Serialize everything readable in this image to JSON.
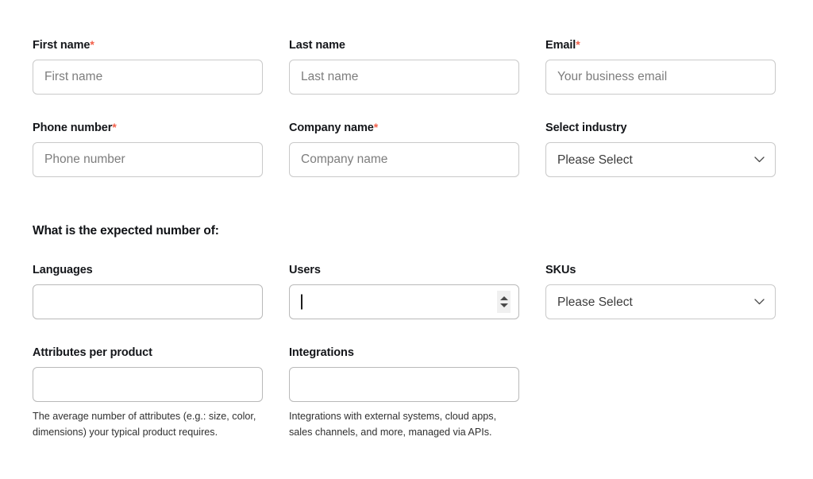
{
  "section": {
    "expected_number_heading": "What is the expected number of:"
  },
  "colors": {
    "required_asterisk": "#f2604a",
    "border": "#c9c9c9",
    "label_text": "#14161a",
    "placeholder": "#7d7d7d",
    "help_text": "#2f2f2f",
    "stepper_bg": "#f0f0f0"
  },
  "fields": {
    "first_name": {
      "label": "First name",
      "required_mark": "*",
      "placeholder": "First name",
      "value": ""
    },
    "last_name": {
      "label": "Last name",
      "required_mark": "",
      "placeholder": "Last name",
      "value": ""
    },
    "email": {
      "label": "Email",
      "required_mark": "*",
      "placeholder": "Your business email",
      "value": ""
    },
    "phone_number": {
      "label": "Phone number",
      "required_mark": "*",
      "placeholder": "Phone number",
      "value": ""
    },
    "company_name": {
      "label": "Company name",
      "required_mark": "*",
      "placeholder": "Company name",
      "value": ""
    },
    "industry": {
      "label": "Select industry",
      "required_mark": "",
      "selected": "Please Select",
      "icon": "chevron-down-icon"
    },
    "languages": {
      "label": "Languages",
      "required_mark": "",
      "placeholder": "",
      "value": ""
    },
    "users": {
      "label": "Users",
      "required_mark": "",
      "placeholder": "",
      "value": "",
      "focused": true,
      "stepper_up_icon": "triangle-up-icon",
      "stepper_down_icon": "triangle-down-icon"
    },
    "skus": {
      "label": "SKUs",
      "required_mark": "",
      "selected": "Please Select",
      "icon": "chevron-down-icon"
    },
    "attributes_per_product": {
      "label": "Attributes per product",
      "required_mark": "",
      "placeholder": "",
      "value": "",
      "help": "The average number of attributes (e.g.: size, color, dimensions) your typical product requires."
    },
    "integrations": {
      "label": "Integrations",
      "required_mark": "",
      "placeholder": "",
      "value": "",
      "help": "Integrations with external systems, cloud apps, sales channels, and more, managed via APIs."
    }
  }
}
